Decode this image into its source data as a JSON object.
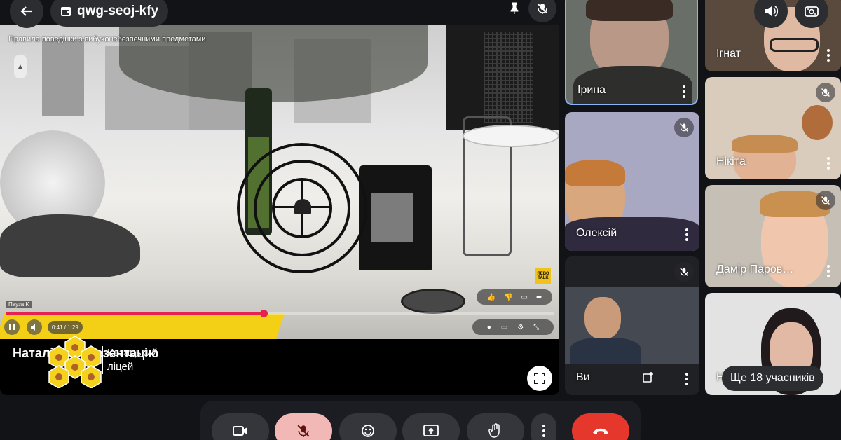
{
  "meeting": {
    "code": "qwg-seoj-kfy"
  },
  "presentation": {
    "video_caption": "Правила поведінки з вибухонебезпечними предметами",
    "tag": "Пауза  K",
    "time": "0:41 / 1:29",
    "progress": 0.47,
    "presenter_label": "Наталія … презентацію",
    "corner_logo": "ЯЕВО TALK"
  },
  "watermark": {
    "school_name_line1": "Козацький",
    "school_name_line2": "ліцей"
  },
  "participants": [
    {
      "name": "Ірина",
      "mic_muted": false,
      "active": true
    },
    {
      "name": "Олексій",
      "mic_muted": true
    },
    {
      "name": "Ви",
      "mic_muted": true
    },
    {
      "name": "Ігнат",
      "mic_muted": false
    },
    {
      "name": "Нікіта",
      "mic_muted": true
    },
    {
      "name": "Дамір Паров…",
      "mic_muted": true
    },
    {
      "name": "Н",
      "mic_muted": false
    }
  ],
  "overflow": {
    "label": "Ще 18 учасників"
  },
  "colors": {
    "background": "#121317",
    "tile_bg": "#3a3b3f",
    "active_border": "#8ab4f8",
    "mic_on_bg": "#f2b8b5",
    "hangup": "#e5372c",
    "progress": "#e8224f"
  },
  "icons": {
    "back": "arrow-left-icon",
    "calendar": "calendar-icon",
    "pin": "pin-icon",
    "mic_off": "mic-off-icon",
    "volume": "volume-icon",
    "switch_camera": "switch-camera-icon",
    "fullscreen": "fullscreen-icon",
    "camera": "camera-icon",
    "emoji": "emoji-icon",
    "present": "present-icon",
    "hand": "raise-hand-icon",
    "more": "more-vert-icon",
    "hangup": "hangup-icon"
  }
}
